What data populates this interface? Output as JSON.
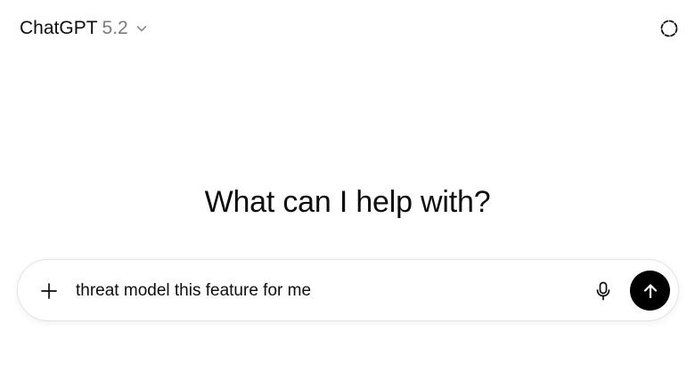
{
  "header": {
    "model_name": "ChatGPT",
    "model_version": "5.2",
    "model_dropdown_icon": "chevron-down-icon",
    "temporary_chat_icon": "dashed-circle-icon"
  },
  "main": {
    "heading": "What can I help with?"
  },
  "composer": {
    "add_icon": "plus-icon",
    "input_value": "threat model this feature for me",
    "mic_icon": "microphone-icon",
    "send_icon": "arrow-up-icon"
  },
  "colors": {
    "text": "#0d0d0d",
    "muted": "#7b7b7b",
    "send_button_bg": "#000000",
    "composer_border": "#e3e3e3"
  }
}
